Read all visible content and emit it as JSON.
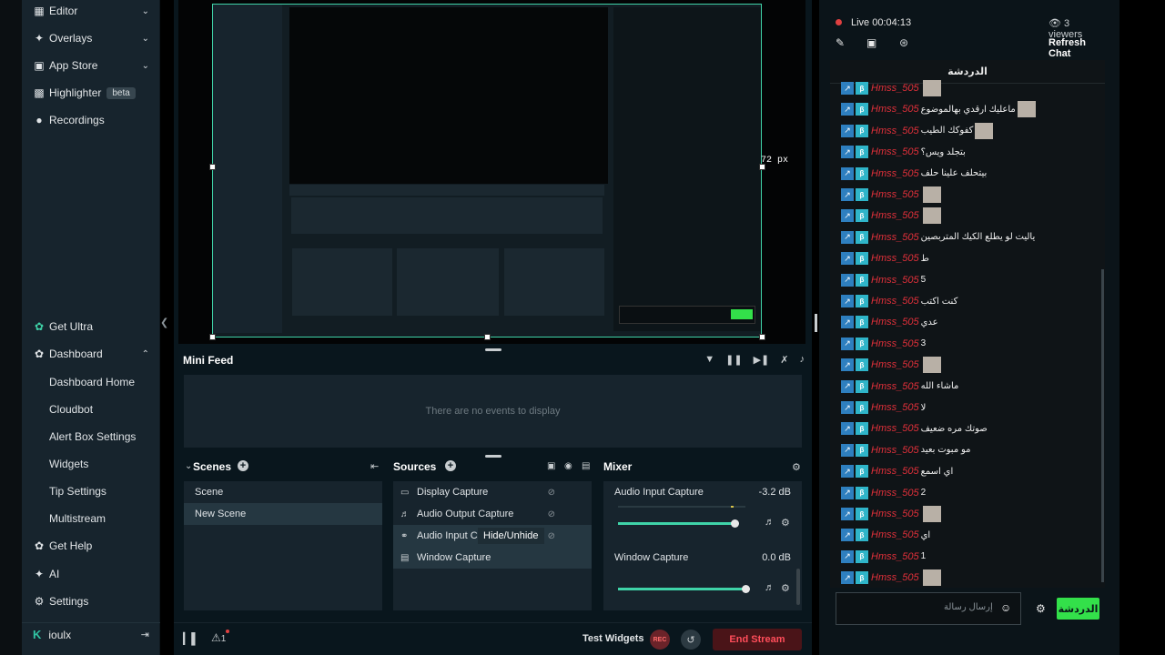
{
  "sidebar": {
    "items_top": [
      {
        "label": "Editor",
        "icon": "editor-icon"
      },
      {
        "label": "Overlays",
        "icon": "overlays-icon"
      },
      {
        "label": "App Store",
        "icon": "store-icon"
      },
      {
        "label": "Highlighter",
        "icon": "highlighter-icon",
        "badge": "beta"
      },
      {
        "label": "Recordings",
        "icon": "recordings-icon"
      }
    ],
    "get_ultra": "Get Ultra",
    "dashboard": "Dashboard",
    "dashboard_sub": [
      "Dashboard Home",
      "Cloudbot",
      "Alert Box Settings",
      "Widgets",
      "Tip Settings",
      "Multistream"
    ],
    "get_help": "Get Help",
    "ai": "AI",
    "settings": "Settings",
    "username": "ioulx",
    "user_badge": "K"
  },
  "preview": {
    "size_label": "72 px"
  },
  "minifeed": {
    "title": "Mini Feed",
    "empty": "There are no events to display"
  },
  "scenes": {
    "title": "Scenes",
    "items": [
      "Scene",
      "New Scene"
    ],
    "selected": "New Scene"
  },
  "sources": {
    "title": "Sources",
    "items": [
      "Display Capture",
      "Audio Output Capture",
      "Audio Input C",
      "Window Capture"
    ],
    "tooltip": "Hide/Unhide"
  },
  "mixer": {
    "title": "Mixer",
    "channels": [
      {
        "name": "Audio Input Capture",
        "db": "-3.2 dB",
        "level": 0.9
      },
      {
        "name": "Window Capture",
        "db": "0.0 dB",
        "level": 0.96
      }
    ]
  },
  "footer": {
    "test_widgets": "Test Widgets",
    "rec": "REC",
    "end_stream": "End Stream",
    "alerts_count": "1"
  },
  "chat_header": {
    "live": "Live",
    "timer": "00:04:13",
    "viewers": "3 viewers",
    "refresh": "Refresh Chat"
  },
  "chat": {
    "title": "الدردشة",
    "messages": [
      {
        "user": "Hmss_505",
        "text": "",
        "img": true
      },
      {
        "user": "Hmss_505",
        "text": "ماعليك ارقدي بهالموضوع",
        "img": true
      },
      {
        "user": "Hmss_505",
        "text": "كفوكك الطيب",
        "img": true
      },
      {
        "user": "Hmss_505",
        "text": "بتجلد ويس؟",
        "img": false
      },
      {
        "user": "Hmss_505",
        "text": "بيتحلف علينا حلف",
        "img": false
      },
      {
        "user": "Hmss_505",
        "text": "",
        "img": true
      },
      {
        "user": "Hmss_505",
        "text": "",
        "img": true
      },
      {
        "user": "Hmss_505",
        "text": "ياليت لو يطلع الكيك المتربصين",
        "img": false
      },
      {
        "user": "Hmss_505",
        "text": "ط",
        "img": false
      },
      {
        "user": "Hmss_505",
        "text": "5",
        "img": false
      },
      {
        "user": "Hmss_505",
        "text": "كنت اكتب",
        "img": false
      },
      {
        "user": "Hmss_505",
        "text": "عدي",
        "img": false
      },
      {
        "user": "Hmss_505",
        "text": "3",
        "img": false
      },
      {
        "user": "Hmss_505",
        "text": "",
        "img": true
      },
      {
        "user": "Hmss_505",
        "text": "ماشاء الله",
        "img": false
      },
      {
        "user": "Hmss_505",
        "text": "لا",
        "img": false
      },
      {
        "user": "Hmss_505",
        "text": "صوتك مره ضعيف",
        "img": false
      },
      {
        "user": "Hmss_505",
        "text": "مو مبوت بعيد",
        "img": false
      },
      {
        "user": "Hmss_505",
        "text": "اي اسمع",
        "img": false
      },
      {
        "user": "Hmss_505",
        "text": "2",
        "img": false
      },
      {
        "user": "Hmss_505",
        "text": "",
        "img": true
      },
      {
        "user": "Hmss_505",
        "text": "اي",
        "img": false
      },
      {
        "user": "Hmss_505",
        "text": "1",
        "img": false
      },
      {
        "user": "Hmss_505",
        "text": "",
        "img": true
      }
    ],
    "input_placeholder": "إرسال رسالة",
    "send": "الدردشة"
  },
  "colors": {
    "accent": "#3fd3a8",
    "brand_green": "#33e04a",
    "danger": "#e0303a"
  }
}
